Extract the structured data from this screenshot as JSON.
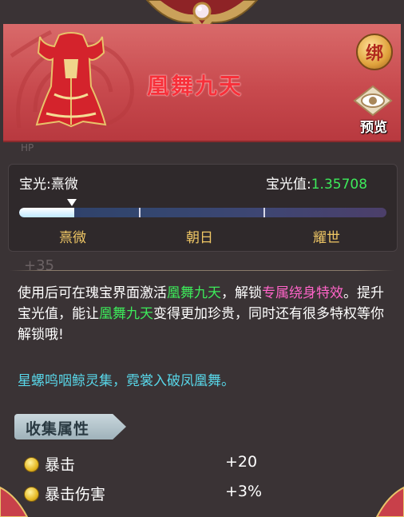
{
  "item": {
    "name": "凰舞九天",
    "bind_label": "绑",
    "preview_label": "预览"
  },
  "baoguang": {
    "label_prefix": "宝光:",
    "current_level": "熹微",
    "value_label": "宝光值:",
    "value": "1.35708",
    "progress": 0.15,
    "levels": [
      "熹微",
      "朝日",
      "耀世"
    ]
  },
  "description": {
    "p1": "使用后可在瑰宝界面激活",
    "h1": "凰舞九天",
    "p2": "，解锁",
    "h2": "专属绕身特效",
    "p3": "。提升宝光值，能让",
    "h3": "凰舞九天",
    "p4": "变得更加珍贵，同时还有很多特权等你解锁哦!"
  },
  "poem": "星螺鸣咽鲸灵集，霓裳入破凤凰舞。",
  "attributes": {
    "title": "收集属性",
    "items": [
      {
        "name": "暴击",
        "value": "+20"
      },
      {
        "name": "暴击伤害",
        "value": "+3%"
      }
    ]
  },
  "background_labels": [
    "+35",
    "+35"
  ],
  "colors": {
    "highlight_green": "#3dea5a",
    "highlight_pink": "#ff64c8",
    "poem_cyan": "#58d6e8",
    "level_gold": "#f0c765",
    "name_red": "#f7303a"
  }
}
